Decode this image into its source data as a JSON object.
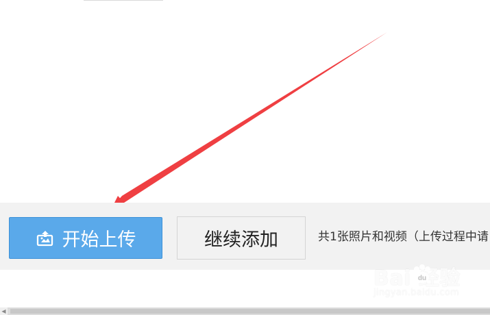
{
  "buttons": {
    "start_upload": "开始上传",
    "continue_add": "继续添加"
  },
  "summary": {
    "text": "共1张照片和视频（上传过程中请"
  },
  "watermark": {
    "main": "Bai  经验",
    "sub": "jingyan.baidu.com"
  },
  "icons": {
    "upload": "upload-image-icon",
    "arrow": "red-arrow-annotation",
    "scroll_left": "scroll-left-arrow-icon"
  },
  "colors": {
    "primary_button": "#5aa9ea",
    "primary_border": "#3d91d8",
    "toolbar_bg": "#f2f2f2",
    "arrow": "#ef3f42"
  }
}
